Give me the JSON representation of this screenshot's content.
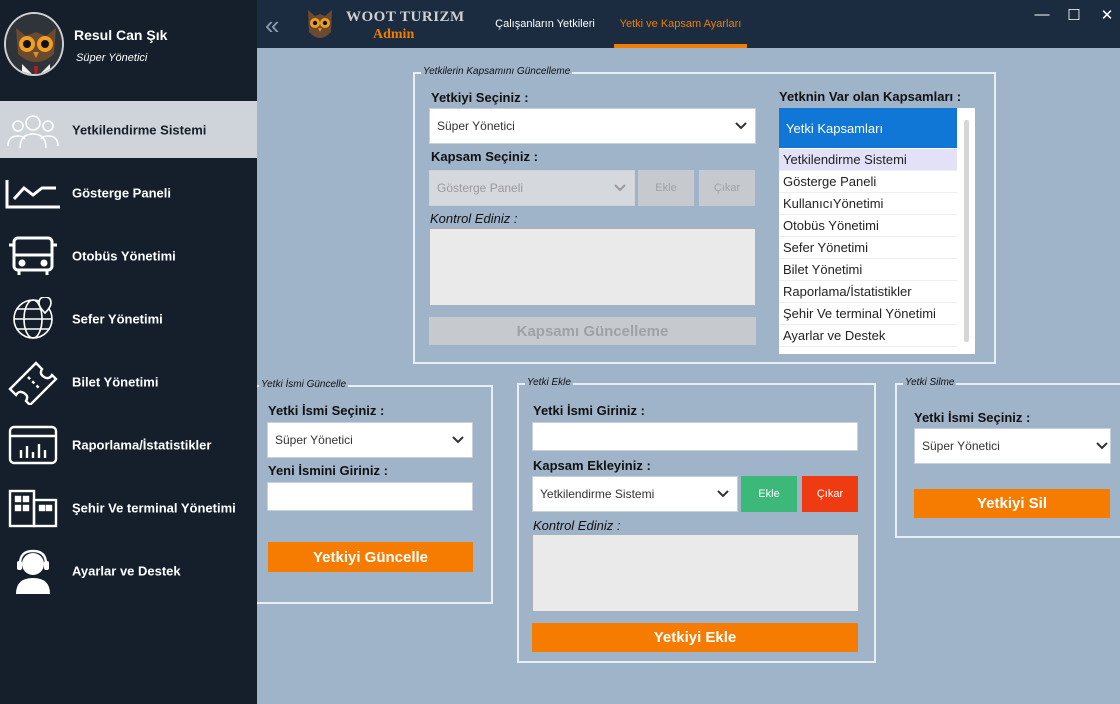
{
  "user": {
    "name": "Resul Can Şık",
    "role": "Süper Yönetici"
  },
  "sidebar": {
    "items": [
      {
        "label": "Yetkilendirme Sistemi",
        "icon": "users-icon",
        "active": true
      },
      {
        "label": "Gösterge Paneli",
        "icon": "chart-icon"
      },
      {
        "label": "Otobüs Yönetimi",
        "icon": "bus-icon"
      },
      {
        "label": "Sefer Yönetimi",
        "icon": "globe-pin-icon"
      },
      {
        "label": "Bilet Yönetimi",
        "icon": "ticket-icon"
      },
      {
        "label": "Raporlama/İstatistikler",
        "icon": "report-icon"
      },
      {
        "label": "Şehir Ve terminal Yönetimi",
        "icon": "building-icon"
      },
      {
        "label": "Ayarlar ve Destek",
        "icon": "headset-icon"
      }
    ]
  },
  "topbar": {
    "brand": "WOOT TURIZM",
    "brand_sub": "Admin",
    "tabs": [
      {
        "label": "Çalışanların Yetkileri"
      },
      {
        "label": "Yetki ve Kapsam Ayarları",
        "active": true
      }
    ],
    "controls": {
      "minimize": "—",
      "maximize": "☐",
      "close": "✕"
    }
  },
  "scope_update": {
    "title": "Yetkilerin Kapsamını Güncelleme",
    "select_role_label": "Yetkiyi Seçiniz :",
    "select_role_value": "Süper Yönetici",
    "select_scope_label": "Kapsam Seçiniz :",
    "select_scope_value": "Gösterge Paneli",
    "add_label": "Ekle",
    "remove_label": "Çıkar",
    "check_label": "Kontrol Ediniz :",
    "submit_label": "Kapsamı Güncelleme",
    "existing_label": "Yetknin Var olan Kapsamları :",
    "list_header": "Yetki Kapsamları",
    "list_items": [
      "Yetkilendirme Sistemi",
      "Gösterge Paneli",
      "KullanıcıYönetimi",
      "Otobüs Yönetimi",
      "Sefer Yönetimi",
      "Bilet Yönetimi",
      "Raporlama/İstatistikler",
      "Şehir Ve terminal Yönetimi",
      "Ayarlar ve Destek"
    ]
  },
  "rename": {
    "title": "Yetki İsmi Güncelle",
    "select_label": "Yetki İsmi Seçiniz :",
    "select_value": "Süper Yönetici",
    "new_name_label": "Yeni İsmini Giriniz :",
    "new_name_value": "",
    "submit_label": "Yetkiyi Güncelle"
  },
  "add": {
    "title": "Yetki Ekle",
    "name_label": "Yetki İsmi Giriniz :",
    "name_value": "",
    "scope_label": "Kapsam Ekleyiniz :",
    "scope_value": "Yetkilendirme Sistemi",
    "add_label": "Ekle",
    "remove_label": "Çıkar",
    "check_label": "Kontrol Ediniz :",
    "submit_label": "Yetkiyi Ekle"
  },
  "delete": {
    "title": "Yetki Silme",
    "select_label": "Yetki İsmi Seçiniz :",
    "select_value": "Süper Yönetici",
    "submit_label": "Yetkiyi Sil"
  },
  "colors": {
    "accent": "#f57c00",
    "sidebar": "#141f2b",
    "topbar": "#1c2c40",
    "list_header": "#1177d7",
    "add_green": "#3cb878",
    "remove_red": "#ee3b12"
  }
}
